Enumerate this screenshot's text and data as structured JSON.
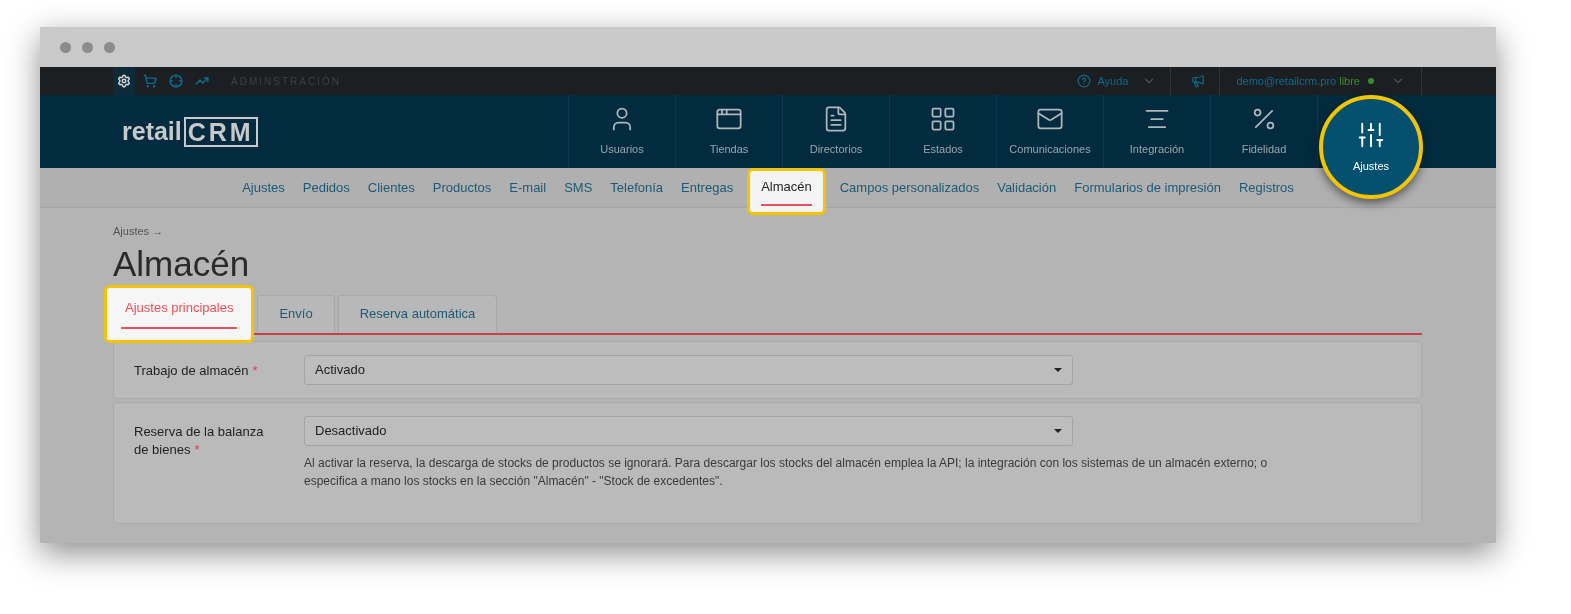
{
  "top_bar": {
    "icons": [
      {
        "kind": "gear",
        "selected": true
      },
      {
        "kind": "cart",
        "selected": false
      },
      {
        "kind": "target",
        "selected": false
      },
      {
        "kind": "chart",
        "selected": false
      }
    ],
    "section_label": "ADMINSTRACIÓN",
    "help": "Ayuda",
    "user_email": "demo@retailcrm.pro",
    "plan": "libre"
  },
  "logo": {
    "text": "retail",
    "mark": "CRM"
  },
  "nav": [
    {
      "label": "Usuarios",
      "kind": "user",
      "selected": false
    },
    {
      "label": "Tiendas",
      "kind": "window",
      "selected": false
    },
    {
      "label": "Directorios",
      "kind": "document",
      "selected": false
    },
    {
      "label": "Estados",
      "kind": "grid",
      "selected": false
    },
    {
      "label": "Comunicaciones",
      "kind": "mail",
      "selected": false
    },
    {
      "label": "Integración",
      "kind": "lines",
      "selected": false
    },
    {
      "label": "Fidelidad",
      "kind": "percent",
      "selected": false
    },
    {
      "label": "Ajustes",
      "kind": "sliders",
      "selected": true
    }
  ],
  "subnav": [
    {
      "label": "Ajustes",
      "selected": false
    },
    {
      "label": "Pedidos",
      "selected": false
    },
    {
      "label": "Clientes",
      "selected": false
    },
    {
      "label": "Productos",
      "selected": false
    },
    {
      "label": "E-mail",
      "selected": false
    },
    {
      "label": "SMS",
      "selected": false
    },
    {
      "label": "Telefonía",
      "selected": false
    },
    {
      "label": "Entregas",
      "selected": false
    },
    {
      "label": "Almacén",
      "selected": true
    },
    {
      "label": "Campos personalizados",
      "selected": false
    },
    {
      "label": "Validación",
      "selected": false
    },
    {
      "label": "Formularios de impresión",
      "selected": false
    },
    {
      "label": "Registros",
      "selected": false
    }
  ],
  "breadcrumb": "Ajustes →",
  "title": "Almacén",
  "tabs": [
    {
      "label": "Ajustes principales",
      "selected": true
    },
    {
      "label": "Envío",
      "selected": false
    },
    {
      "label": "Reserva automática",
      "selected": false
    }
  ],
  "fields": [
    {
      "label": "Trabajo de almacén",
      "required_mark": "*",
      "value": "Activado"
    },
    {
      "label": "Reserva de la balanza de bienes",
      "required_mark": "*",
      "value": "Desactivado",
      "hint": "Al activar la reserva, la descarga de stocks de productos se ignorará. Para descargar los stocks del almacén emplea la API; la integración con los sistemas de un almacén externo; o especifica a mano los stocks en la sección \"Almacén\" - \"Stock de excedentes\"."
    }
  ]
}
